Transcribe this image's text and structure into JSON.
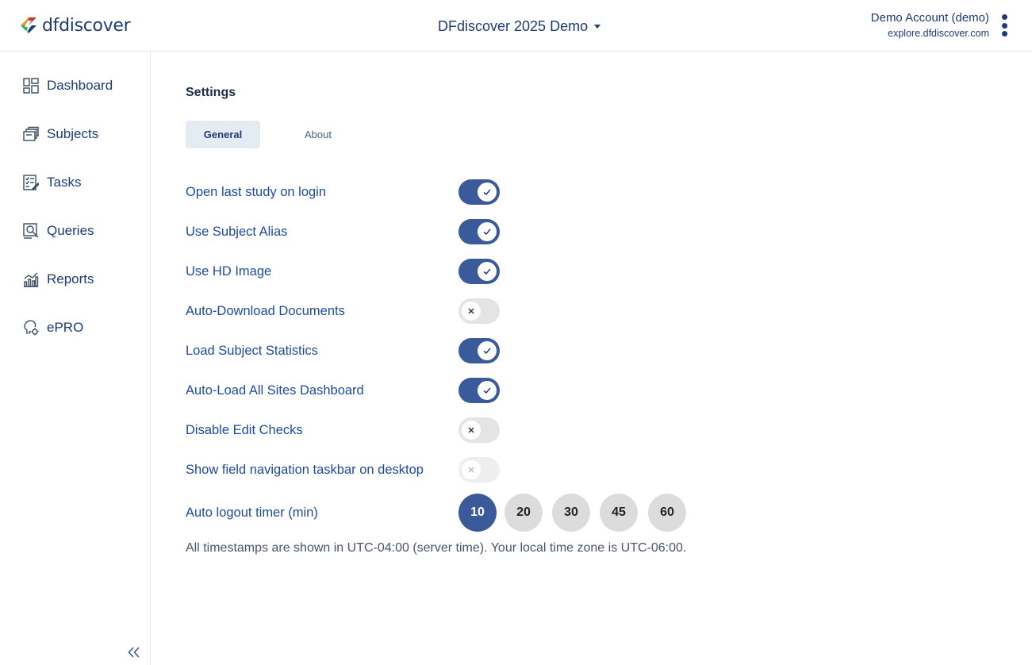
{
  "header": {
    "logo_text": "dfdiscover",
    "study_name": "DFdiscover 2025 Demo",
    "account_name": "Demo Account (demo)",
    "account_host": "explore.dfdiscover.com"
  },
  "sidebar": {
    "items": [
      {
        "label": "Dashboard",
        "icon": "dashboard-icon"
      },
      {
        "label": "Subjects",
        "icon": "subjects-icon"
      },
      {
        "label": "Tasks",
        "icon": "tasks-icon"
      },
      {
        "label": "Queries",
        "icon": "queries-icon"
      },
      {
        "label": "Reports",
        "icon": "reports-icon"
      },
      {
        "label": "ePRO",
        "icon": "epro-icon"
      }
    ],
    "collapse_icon": "double-chevron-left-icon"
  },
  "main": {
    "title": "Settings",
    "tabs": [
      {
        "label": "General",
        "selected": true
      },
      {
        "label": "About",
        "selected": false
      }
    ],
    "settings": [
      {
        "label": "Open last study on login",
        "state": "on"
      },
      {
        "label": "Use Subject Alias",
        "state": "on"
      },
      {
        "label": "Use HD Image",
        "state": "on"
      },
      {
        "label": "Auto-Download Documents",
        "state": "off"
      },
      {
        "label": "Load Subject Statistics",
        "state": "on"
      },
      {
        "label": "Auto-Load All Sites Dashboard",
        "state": "on"
      },
      {
        "label": "Disable Edit Checks",
        "state": "off"
      },
      {
        "label": "Show field navigation taskbar on desktop",
        "state": "off-disabled"
      }
    ],
    "auto_logout": {
      "label": "Auto logout timer (min)",
      "options": [
        "10",
        "20",
        "30",
        "45",
        "60"
      ],
      "selected": "10"
    },
    "timezone_note": "All timestamps are shown in UTC-04:00 (server time). Your local time zone is UTC-06:00."
  },
  "colors": {
    "primary": "#3a5a99",
    "text_dark_blue": "#1f3b73",
    "toggle_off": "#e4e4e4",
    "tab_selected_bg": "#e5ebf2"
  }
}
